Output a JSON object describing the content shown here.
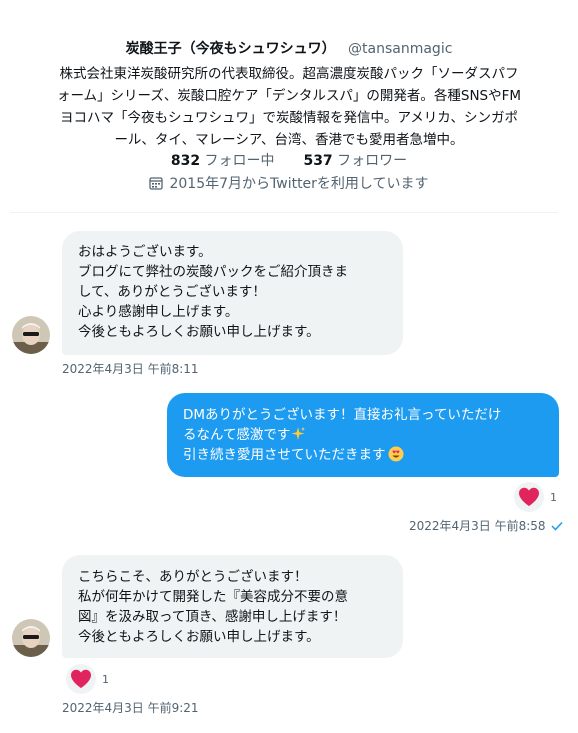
{
  "profile": {
    "display_name": "炭酸王子（今夜もシュワシュワ）",
    "handle": "@tansanmagic",
    "bio_lines": [
      "株式会社東洋炭酸研究所の代表取締役。超高濃度炭酸パック「ソーダスパフ",
      "ォーム」シリーズ、炭酸口腔ケア「デンタルスパ」の開発者。各種SNSやFM",
      "ヨコハマ「今夜もシュワシュワ」で炭酸情報を発信中。アメリカ、シンガポ",
      "ール、タイ、マレーシア、台湾、香港でも愛用者急増中。"
    ],
    "following_count": "832",
    "following_label": "フォロー中",
    "followers_count": "537",
    "followers_label": "フォロワー",
    "joined_text": "2015年7月からTwitterを利用しています",
    "joined_icon": "calendar-icon"
  },
  "messages": [
    {
      "direction": "incoming",
      "lines": [
        "おはようございます。",
        "ブログにて弊社の炭酸パックをご紹介頂きま",
        "して、ありがとうございます！",
        "心より感謝申し上げます。",
        "今後ともよろしくお願い申し上げます。"
      ],
      "timestamp": "2022年4月3日 午前8:11"
    },
    {
      "direction": "outgoing",
      "lines": [
        "DMありがとうございます！直接お礼言っていただけ",
        "るなんて感激です",
        "引き続き愛用させていただきます"
      ],
      "emojis": [
        "sparkles-emoji",
        "heart-eyes-emoji"
      ],
      "reaction": {
        "icon": "heart-icon",
        "count": "1"
      },
      "timestamp": "2022年4月3日 午前8:58",
      "status_icon": "checkmark-icon"
    },
    {
      "direction": "incoming",
      "lines": [
        "こちらこそ、ありがとうございます！",
        "私が何年かけて開発した『美容成分不要の意",
        "図』を汲み取って頂き、感謝申し上げます！",
        "今後ともよろしくお願い申し上げます。"
      ],
      "reaction": {
        "icon": "heart-icon",
        "count": "1"
      },
      "timestamp": "2022年4月3日 午前9:21"
    }
  ],
  "colors": {
    "accent": "#1d9bf0",
    "incoming_bubble": "#eff3f4",
    "heart": "#f91880",
    "secondary_text": "#536471"
  }
}
